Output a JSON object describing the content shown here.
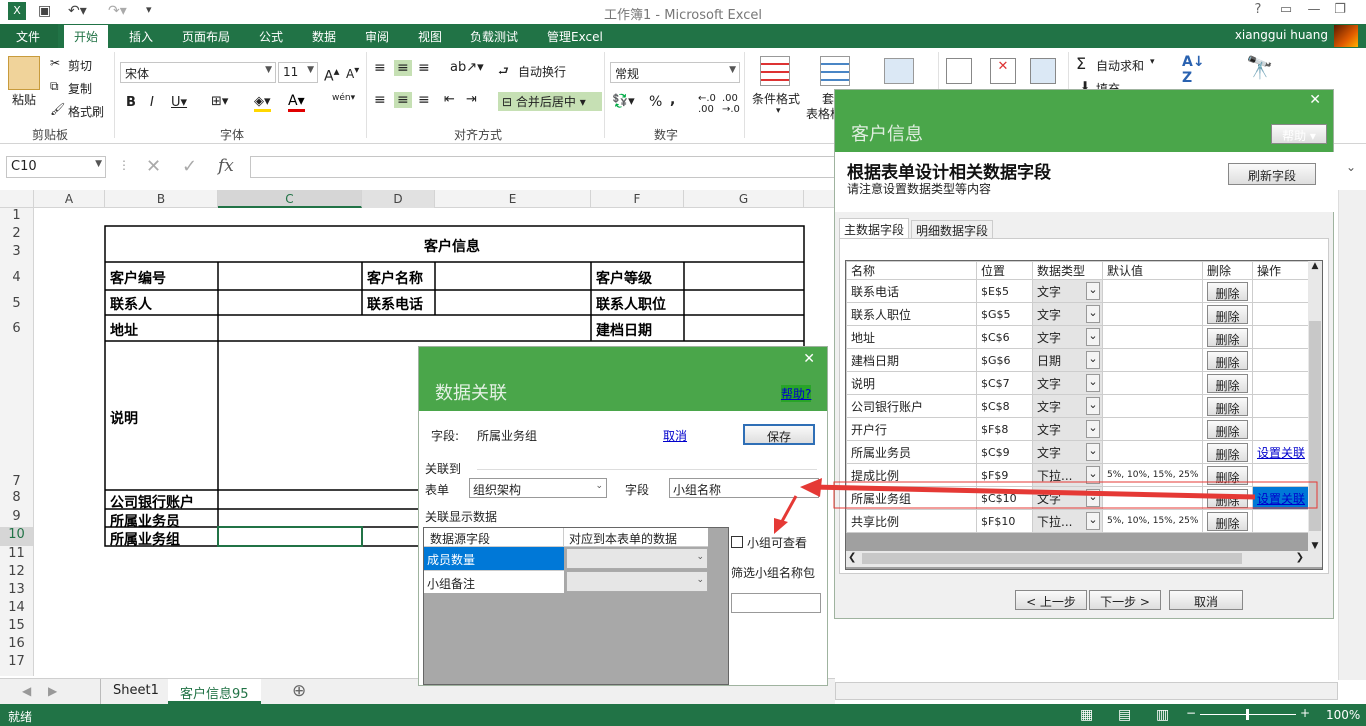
{
  "titlebar": {
    "title": "工作簿1 - Microsoft Excel"
  },
  "tabs": [
    "文件",
    "开始",
    "插入",
    "页面布局",
    "公式",
    "数据",
    "审阅",
    "视图",
    "负载测试",
    "管理Excel"
  ],
  "user": "xianggui huang",
  "ribbon": {
    "clipboard": {
      "paste": "粘贴",
      "cut": "剪切",
      "copy": "复制",
      "format_painter": "格式刷",
      "label": "剪贴板"
    },
    "font": {
      "name": "宋体",
      "size": "11",
      "label": "字体",
      "phonetic": "wén"
    },
    "alignment": {
      "wrap": "自动换行",
      "merge": "合并后居中",
      "label": "对齐方式"
    },
    "number": {
      "format": "常规",
      "label": "数字",
      "percent": "%"
    },
    "styles": {
      "conditional": "条件格式",
      "table": "套用表格格式"
    },
    "editing": {
      "autosum": "自动求和",
      "fill": "填充"
    }
  },
  "formula_bar": {
    "namebox": "C10",
    "fx": "fx",
    "value": ""
  },
  "grid": {
    "columns": [
      "A",
      "B",
      "C",
      "D",
      "E",
      "F",
      "G"
    ],
    "rows": [
      "1",
      "2",
      "3",
      "4",
      "5",
      "6",
      "7",
      "8",
      "9",
      "10",
      "11",
      "12",
      "13",
      "14",
      "15",
      "16",
      "17"
    ],
    "cells": {
      "title": "客户信息",
      "b4": "客户编号",
      "d4": "客户名称",
      "f4": "客户等级",
      "b5": "联系人",
      "d5": "联系电话",
      "f5": "联系人职位",
      "b6": "地址",
      "f6": "建档日期",
      "b7": "说明",
      "b8": "公司银行账户",
      "b9": "所属业务员",
      "b10": "所属业务组"
    }
  },
  "sheets": {
    "tabs": [
      "Sheet1",
      "客户信息95"
    ],
    "active": "客户信息95",
    "add": "⊕"
  },
  "status": {
    "left": "就绪",
    "zoom": "100%"
  },
  "customer_dialog": {
    "title": "客户信息",
    "help": "帮助",
    "heading": "根据表单设计相关数据字段",
    "subheading": "请注意设置数据类型等内容",
    "refresh": "刷新字段",
    "tabs": [
      "主数据字段",
      "明细数据字段"
    ],
    "columns": [
      "名称",
      "位置",
      "数据类型",
      "默认值",
      "删除",
      "操作"
    ],
    "rows": [
      {
        "name": "联系电话",
        "pos": "$E$5",
        "type": "文字",
        "default": "",
        "del": "删除",
        "op": ""
      },
      {
        "name": "联系人职位",
        "pos": "$G$5",
        "type": "文字",
        "default": "",
        "del": "删除",
        "op": ""
      },
      {
        "name": "地址",
        "pos": "$C$6",
        "type": "文字",
        "default": "",
        "del": "删除",
        "op": ""
      },
      {
        "name": "建档日期",
        "pos": "$G$6",
        "type": "日期",
        "default": "",
        "del": "删除",
        "op": ""
      },
      {
        "name": "说明",
        "pos": "$C$7",
        "type": "文字",
        "default": "",
        "del": "删除",
        "op": ""
      },
      {
        "name": "公司银行账户",
        "pos": "$C$8",
        "type": "文字",
        "default": "",
        "del": "删除",
        "op": ""
      },
      {
        "name": "开户行",
        "pos": "$F$8",
        "type": "文字",
        "default": "",
        "del": "删除",
        "op": ""
      },
      {
        "name": "所属业务员",
        "pos": "$C$9",
        "type": "文字",
        "default": "",
        "del": "删除",
        "op": "设置关联"
      },
      {
        "name": "提成比例",
        "pos": "$F$9",
        "type": "下拉...",
        "default": "5%, 10%, 15%, 25%",
        "del": "删除",
        "op": ""
      },
      {
        "name": "所属业务组",
        "pos": "$C$10",
        "type": "文字",
        "default": "",
        "del": "删除",
        "op": "设置关联"
      },
      {
        "name": "共享比例",
        "pos": "$F$10",
        "type": "下拉...",
        "default": "5%, 10%, 15%, 25%",
        "del": "删除",
        "op": ""
      }
    ],
    "prev": "< 上一步",
    "next": "下一步 >",
    "cancel": "取消"
  },
  "relation_dialog": {
    "title": "数据关联",
    "help": "帮助?",
    "field_label": "字段:",
    "field_value": "所属业务组",
    "cancel": "取消",
    "save": "保存",
    "link_to": "关联到",
    "form_label": "表单",
    "form_value": "组织架构",
    "field2_label": "字段",
    "field2_value": "小组名称",
    "display_label": "关联显示数据",
    "col_source": "数据源字段",
    "col_target": "对应到本表单的数据",
    "rows": [
      "成员数量",
      "小组备注"
    ],
    "checkbox_label": "小组可查看",
    "filter_label": "筛选小组名称包含"
  },
  "colors": {
    "excel_green": "#217346",
    "dialog_green": "#4aa64a",
    "arrow_red": "#e53935",
    "select_blue": "#0078d7"
  }
}
